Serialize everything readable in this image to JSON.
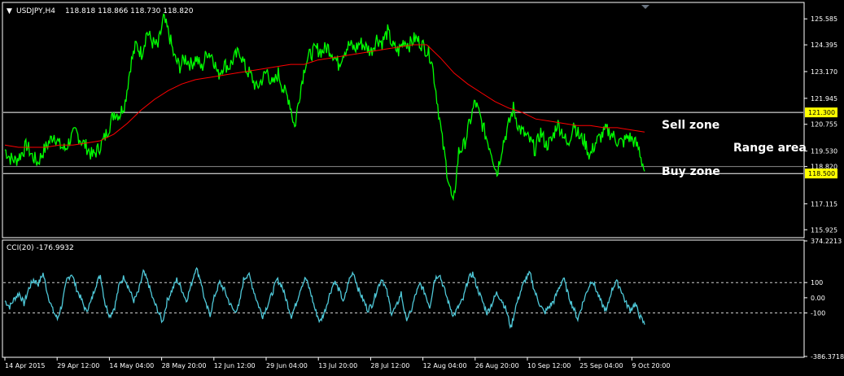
{
  "chart_data": [
    {
      "type": "line",
      "header": {
        "symbol_tf": "USDJPY,H4",
        "ohlc": "118.818 118.866 118.730 118.820"
      },
      "ylim": [
        115.6,
        126.3
      ],
      "y_ticks": [
        "125.585",
        "124.395",
        "123.170",
        "121.945",
        "120.755",
        "119.530",
        "118.820",
        "117.115",
        "115.925"
      ],
      "y_tick_values": [
        125.585,
        124.395,
        123.17,
        121.945,
        120.755,
        119.53,
        118.82,
        117.115,
        115.925
      ],
      "horizontal_lines": [
        {
          "price": 121.3,
          "label": "121.300"
        },
        {
          "price": 118.5,
          "label": "118.500"
        }
      ],
      "current_price_line": 118.82,
      "annotations": [
        "Sell zone",
        "Range area",
        "Buy zone"
      ],
      "series": [
        {
          "color": "#00ff00",
          "values": [
            119.6,
            119.2,
            119.1,
            119.4,
            119.8,
            119.3,
            119.0,
            119.5,
            119.9,
            120.3,
            119.8,
            119.6,
            120.1,
            120.4,
            120.0,
            119.7,
            119.3,
            119.6,
            120.0,
            120.6,
            121.3,
            121.2,
            121.8,
            123.5,
            124.4,
            124.0,
            125.0,
            124.5,
            124.3,
            125.6,
            124.9,
            123.8,
            123.4,
            123.8,
            123.5,
            123.8,
            123.3,
            124.1,
            123.9,
            123.0,
            123.5,
            123.4,
            123.8,
            124.1,
            123.3,
            123.0,
            122.4,
            122.8,
            123.2,
            122.5,
            123.1,
            122.3,
            121.9,
            120.6,
            122.3,
            123.6,
            124.0,
            124.2,
            124.1,
            124.3,
            124.0,
            123.5,
            124.1,
            124.4,
            124.2,
            124.5,
            124.3,
            124.1,
            124.7,
            124.5,
            125.0,
            124.3,
            124.1,
            124.6,
            124.4,
            124.7,
            124.5,
            124.2,
            123.8,
            122.0,
            120.0,
            118.4,
            117.0,
            119.5,
            119.8,
            120.8,
            121.8,
            121.0,
            120.2,
            119.5,
            118.5,
            119.8,
            120.6,
            121.5,
            120.6,
            120.3,
            120.0,
            119.6,
            120.4,
            119.8,
            120.0,
            120.8,
            120.4,
            119.7,
            120.9,
            120.2,
            120.0,
            119.3,
            119.9,
            120.2,
            120.5,
            120.3,
            120.0,
            119.9,
            120.2,
            120.0,
            119.6,
            118.6
          ],
          "x_frac": [
            0,
            1
          ]
        },
        {
          "color": "#ff0000",
          "values": [
            119.8,
            119.7,
            119.7,
            119.7,
            119.8,
            119.8,
            119.9,
            120.0,
            120.3,
            120.8,
            121.4,
            121.9,
            122.3,
            122.6,
            122.8,
            122.9,
            123.0,
            123.1,
            123.2,
            123.3,
            123.4,
            123.5,
            123.5,
            123.7,
            123.8,
            123.9,
            124.0,
            124.1,
            124.2,
            124.3,
            124.4,
            124.4,
            123.8,
            123.1,
            122.6,
            122.2,
            121.8,
            121.5,
            121.3,
            121.0,
            120.9,
            120.8,
            120.7,
            120.7,
            120.6,
            120.6,
            120.5,
            120.4
          ],
          "x_frac": [
            0,
            1
          ]
        }
      ],
      "x_ticks": [
        "14 Apr 2015",
        "29 Apr 12:00",
        "14 May 04:00",
        "28 May 20:00",
        "12 Jun 12:00",
        "29 Jun 04:00",
        "13 Jul 20:00",
        "28 Jul 12:00",
        "12 Aug 04:00",
        "26 Aug 20:00",
        "10 Sep 12:00",
        "25 Sep 04:00",
        "9 Oct 20:00"
      ]
    },
    {
      "type": "line",
      "header": {
        "label": "CCI(20) -176.9932"
      },
      "ylim": [
        -386.3718,
        374.2213
      ],
      "y_ticks": [
        "374.2213",
        "100",
        "0.00",
        "-100",
        "-386.3718"
      ],
      "y_tick_values": [
        374.2213,
        100,
        0,
        -100,
        -386.3718
      ],
      "levels": [
        100,
        -100
      ],
      "series": [
        {
          "color": "#4fc8d8",
          "values": [
            -20,
            -60,
            -5,
            30,
            -40,
            60,
            120,
            90,
            160,
            20,
            -80,
            -140,
            -40,
            120,
            160,
            60,
            -10,
            -90,
            -30,
            80,
            150,
            -40,
            -120,
            -60,
            90,
            140,
            60,
            -20,
            40,
            170,
            100,
            -10,
            -80,
            -160,
            -20,
            50,
            120,
            60,
            -20,
            80,
            200,
            120,
            -40,
            -110,
            20,
            100,
            50,
            -30,
            -90,
            -60,
            120,
            160,
            60,
            -40,
            -120,
            -50,
            30,
            120,
            80,
            -20,
            -120,
            -40,
            70,
            130,
            40,
            -80,
            -160,
            -90,
            20,
            110,
            50,
            -30,
            110,
            170,
            60,
            -10,
            -80,
            -40,
            60,
            130,
            40,
            -100,
            -60,
            30,
            -140,
            -100,
            20,
            90,
            30,
            -60,
            120,
            160,
            60,
            -40,
            -120,
            -60,
            -10,
            120,
            160,
            60,
            -20,
            -100,
            -40,
            30,
            -10,
            -80,
            -200,
            -60,
            40,
            120,
            160,
            40,
            -40,
            -100,
            -60,
            -20,
            60,
            130,
            20,
            -60,
            -140,
            -40,
            50,
            120,
            40,
            -40,
            -90,
            40,
            110,
            60,
            -30,
            -80,
            -40,
            -120,
            -176.99
          ],
          "x_frac": [
            0,
            1
          ]
        }
      ]
    }
  ]
}
